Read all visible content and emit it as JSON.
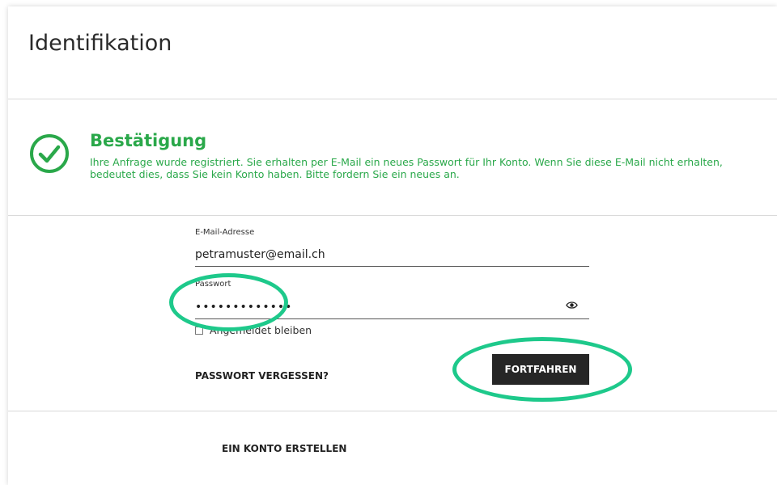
{
  "header": {
    "title": "Identifikation"
  },
  "confirmation": {
    "title": "Bestätigung",
    "message_line1": "Ihre Anfrage wurde registriert. Sie erhalten per E-Mail ein neues Passwort für Ihr Konto. Wenn Sie diese E-Mail nicht erhalten,",
    "message_line2": "bedeutet dies, dass Sie kein Konto haben. Bitte fordern Sie ein neues an.",
    "icon": "check-circle-icon",
    "color": "#2aa84a"
  },
  "form": {
    "email_label": "E-Mail-Adresse",
    "email_value": "petramuster@email.ch",
    "password_label": "Passwort",
    "password_value": "•••••••••••••",
    "show_password_icon": "eye-icon",
    "remember_label": "Angemeldet bleiben",
    "remember_checked": false,
    "forgot_label": "PASSWORT VERGESSEN?",
    "continue_label": "FORTFAHREN"
  },
  "footer": {
    "create_account_label": "EIN KONTO ERSTELLEN"
  },
  "colors": {
    "accent_dark": "#262626",
    "highlight": "#1ec98b"
  }
}
